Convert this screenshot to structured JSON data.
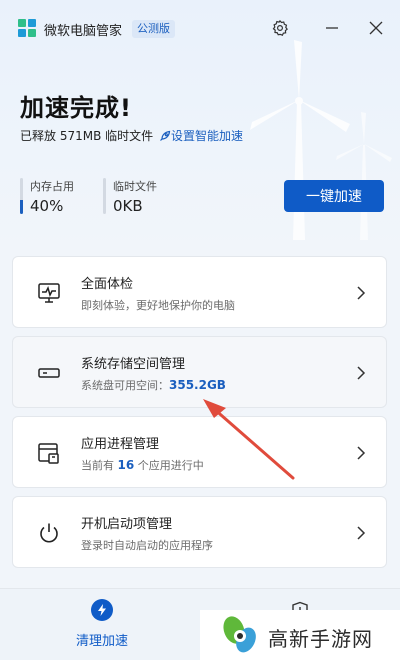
{
  "titlebar": {
    "app_name": "微软电脑管家",
    "edition": "公测版",
    "icons": [
      "app-logo-icon",
      "gear-icon",
      "minimize-icon",
      "close-icon"
    ]
  },
  "hero": {
    "headline": "加速完成!",
    "released_text": "已释放 571MB 临时文件",
    "smart_boost_link": "设置智能加速",
    "stats": [
      {
        "label": "内存占用",
        "value": "40%",
        "fill": 0.4
      },
      {
        "label": "临时文件",
        "value": "0KB",
        "fill": 0
      }
    ],
    "boost_button": "一键加速"
  },
  "cards": [
    {
      "title": "全面体检",
      "desc": "即刻体验，更好地保护你的电脑",
      "icon": "monitor-pulse-icon"
    },
    {
      "title": "系统存储空间管理",
      "desc_prefix": "系统盘可用空间：",
      "desc_value": "355.2GB",
      "icon": "drive-icon"
    },
    {
      "title": "应用进程管理",
      "desc_prefix": "当前有 ",
      "desc_value": "16",
      "desc_suffix": " 个应用进行中",
      "icon": "app-window-icon"
    },
    {
      "title": "开机启动项管理",
      "desc": "登录时自动启动的应用程序",
      "icon": "power-icon"
    }
  ],
  "bottom_nav": {
    "clean_label": "清理加速",
    "icons": [
      "lightning-icon",
      "shield-icon"
    ]
  },
  "watermark": {
    "text": "高新手游网"
  },
  "colors": {
    "accent": "#0f5bc7",
    "link": "#1b5fbf",
    "background": "#f1f5fa",
    "annotation_arrow": "#e04b3c"
  }
}
